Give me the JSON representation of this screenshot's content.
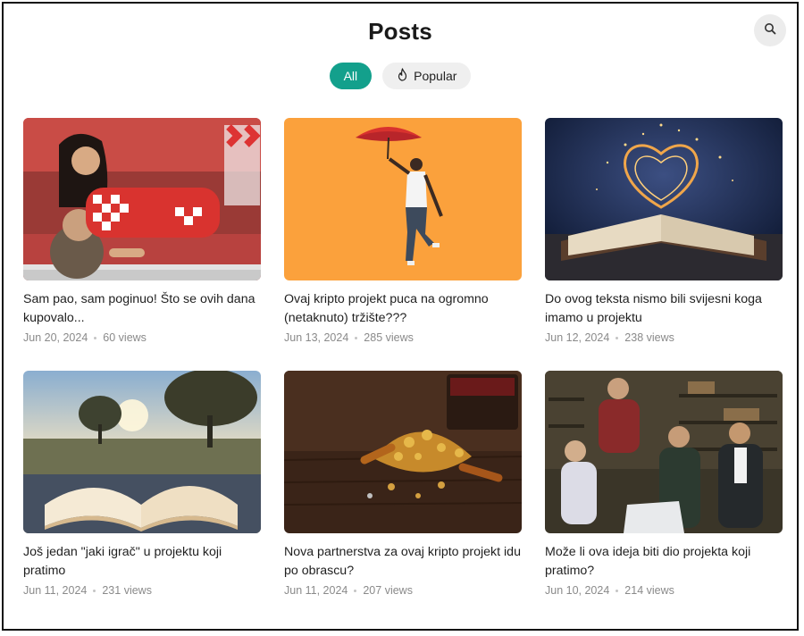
{
  "header": {
    "title": "Posts"
  },
  "search": {
    "icon": "search-icon"
  },
  "filters": [
    {
      "label": "All",
      "active": true
    },
    {
      "label": "Popular",
      "icon": "flame-icon",
      "active": false
    }
  ],
  "posts": [
    {
      "title": "Sam pao, sam poginuo! Što se ovih dana kupovalo...",
      "date": "Jun 20, 2024",
      "views": "60 views"
    },
    {
      "title": "Ovaj kripto projekt puca na ogromno (netaknuto) tržište???",
      "date": "Jun 13, 2024",
      "views": "285 views"
    },
    {
      "title": "Do ovog teksta nismo bili svijesni koga imamo u projektu",
      "date": "Jun 12, 2024",
      "views": "238 views"
    },
    {
      "title": "Još jedan \"jaki igrač\" u projektu koji pratimo",
      "date": "Jun 11, 2024",
      "views": "231 views"
    },
    {
      "title": "Nova partnerstva za ovaj kripto projekt idu po obrascu?",
      "date": "Jun 11, 2024",
      "views": "207 views"
    },
    {
      "title": "Može li ova ideja biti dio projekta koji pratimo?",
      "date": "Jun 10, 2024",
      "views": "214 views"
    }
  ]
}
